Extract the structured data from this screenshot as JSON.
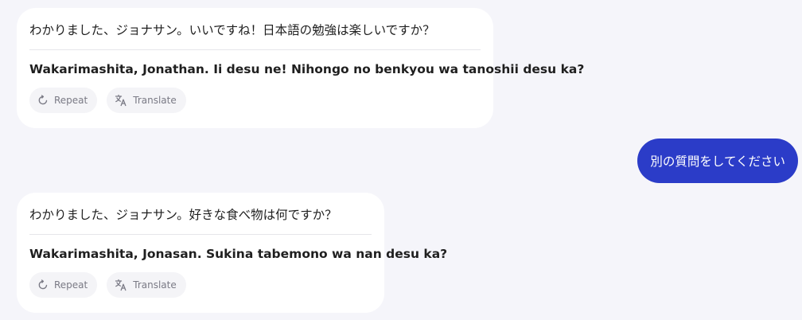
{
  "messages": [
    {
      "role": "assistant",
      "japanese": "わかりました、ジョナサン。いいですね！日本語の勉強は楽しいですか？",
      "romaji": "Wakarimashita, Jonathan. Ii desu ne! Nihongo no benkyou wa tanoshii desu ka?",
      "actions": [
        {
          "label": "Repeat",
          "icon": "repeat-icon"
        },
        {
          "label": "Translate",
          "icon": "translate-icon"
        }
      ]
    },
    {
      "role": "user",
      "text": "別の質問をしてください"
    },
    {
      "role": "assistant",
      "japanese": "わかりました、ジョナサン。好きな食べ物は何ですか？",
      "romaji": "Wakarimashita, Jonasan. Sukina tabemono wa nan desu ka?",
      "actions": [
        {
          "label": "Repeat",
          "icon": "repeat-icon"
        },
        {
          "label": "Translate",
          "icon": "translate-icon"
        }
      ]
    }
  ],
  "colors": {
    "background": "#f5f5fa",
    "assistant_bubble": "#ffffff",
    "user_bubble": "#2b3cc8",
    "action_button": "#f4f4f7"
  }
}
